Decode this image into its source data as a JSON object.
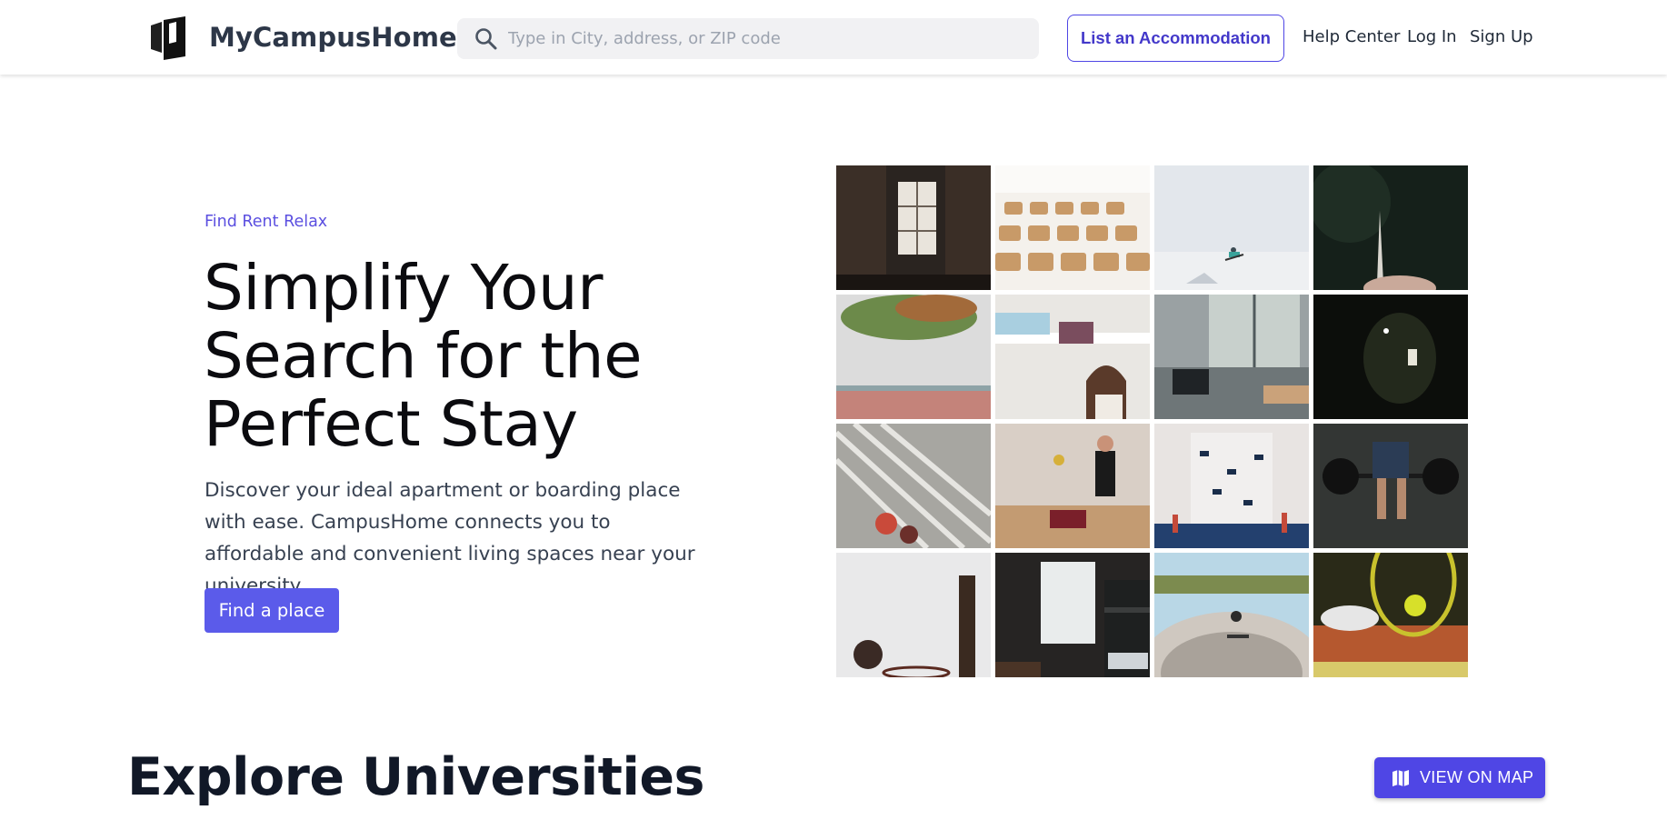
{
  "header": {
    "brand": "MyCampusHome",
    "search_placeholder": "Type in City, address, or ZIP code",
    "list_button": "List an Accommodation",
    "links": [
      "Help Center",
      "Log In",
      "Sign Up"
    ]
  },
  "hero": {
    "eyebrow": "Find Rent Relax",
    "title": "Simplify Your Search for the Perfect Stay",
    "description": "Discover your ideal apartment or boarding place with ease. CampusHome connects you to affordable and convenient living spaces near your university.",
    "cta": "Find a place",
    "images": [
      "library-window",
      "lecture-hall-chairs",
      "snowboarder-sky",
      "dark-plant",
      "tree-building",
      "dorm-bunk-student",
      "room-desk-window",
      "night-phone",
      "stairs-students",
      "volleyball-players",
      "graduation-cap-toss",
      "barbell-lift",
      "basketball-hoop",
      "dorm-bunk-beds",
      "skatepark",
      "tennis-ball-racket"
    ]
  },
  "explore": {
    "title": "Explore Universities",
    "map_button": "VIEW ON MAP",
    "map_icon": "map-icon"
  },
  "colors": {
    "accent": "#4f46e5",
    "cta": "#5b5bea",
    "eyebrow": "#5b4fe0"
  }
}
